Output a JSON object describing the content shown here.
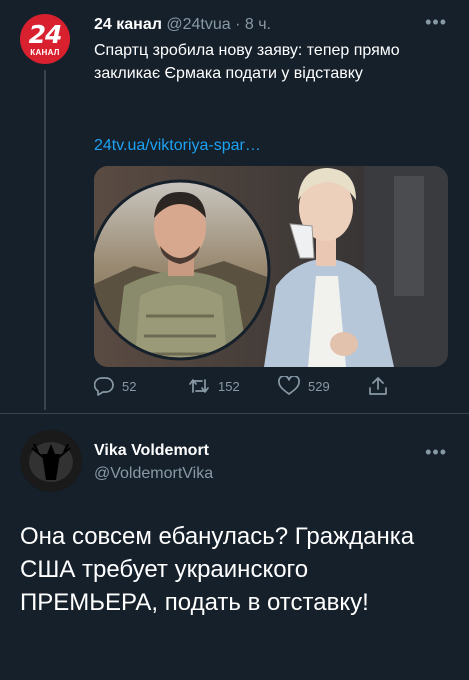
{
  "tweet1": {
    "avatar_text": "24",
    "avatar_sub": "КАНАЛ",
    "author_name": "24 канал",
    "handle": "@24tvua",
    "separator": "·",
    "time": "8 ч.",
    "more_icon": "more-dots-icon",
    "text": "Спартц зробила нову заяву: тепер прямо закликає Єрмака подати у відставку",
    "link": "24tv.ua/viktoriya-spar…",
    "reply_count": "52",
    "retweet_count": "152",
    "like_count": "529"
  },
  "tweet2": {
    "author_name": "Vika Voldemort",
    "handle": "@VoldemortVika",
    "text": "Она совсем ебанулась? Гражданка США требует украинского ПРЕМЬЕРА, подать в отставку!"
  },
  "colors": {
    "background": "#15202b",
    "secondary_text": "#8899a6",
    "link": "#1da1f2",
    "divider": "#38444d",
    "brand_red": "#d9202f"
  }
}
